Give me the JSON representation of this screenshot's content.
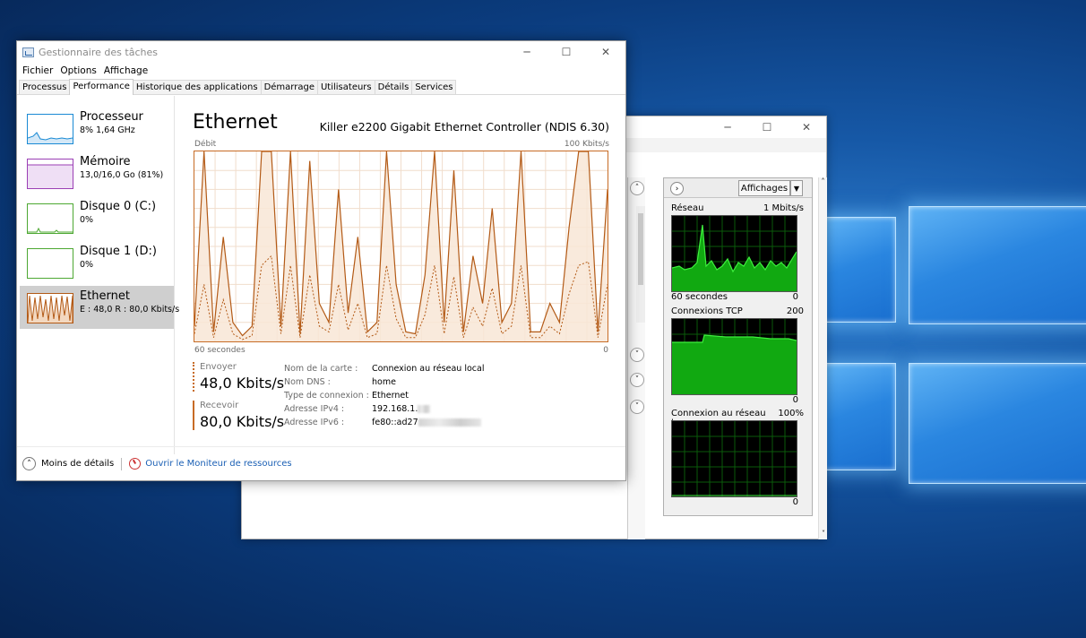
{
  "task_manager": {
    "title": "Gestionnaire des tâches",
    "menu": [
      "Fichier",
      "Options",
      "Affichage"
    ],
    "tabs": [
      "Processus",
      "Performance",
      "Historique des applications",
      "Démarrage",
      "Utilisateurs",
      "Détails",
      "Services"
    ],
    "active_tab": "Performance",
    "sidebar": [
      {
        "name": "Processeur",
        "value": "8% 1,64 GHz",
        "color": "#1a8ad4"
      },
      {
        "name": "Mémoire",
        "value": "13,0/16,0 Go (81%)",
        "color": "#9b3fb5"
      },
      {
        "name": "Disque 0 (C:)",
        "value": "0%",
        "color": "#4da832"
      },
      {
        "name": "Disque 1 (D:)",
        "value": "0%",
        "color": "#4da832"
      },
      {
        "name": "Ethernet",
        "value": "E : 48,0 R : 80,0 Kbits/s",
        "color": "#b35a16"
      }
    ],
    "main": {
      "title": "Ethernet",
      "adapter": "Killer e2200 Gigabit Ethernet Controller (NDIS 6.30)",
      "graph_label": "Débit",
      "graph_max": "100 Kbits/s",
      "graph_time": "60 secondes",
      "graph_min": "0",
      "send_label": "Envoyer",
      "send_value": "48,0 Kbits/s",
      "receive_label": "Recevoir",
      "receive_value": "80,0 Kbits/s",
      "details": [
        {
          "k": "Nom de la carte :",
          "v": "Connexion au réseau local"
        },
        {
          "k": "Nom DNS :",
          "v": "home"
        },
        {
          "k": "Type de connexion :",
          "v": "Ethernet"
        },
        {
          "k": "Adresse IPv4 :",
          "v": "192.168.1."
        },
        {
          "k": "Adresse IPv6 :",
          "v": "fe80::ad27"
        }
      ]
    },
    "footer": {
      "less_details": "Moins de détails",
      "open_monitor": "Ouvrir le Moniteur de ressources"
    },
    "chart_data": {
      "type": "line",
      "ylim": [
        0,
        100
      ],
      "series": [
        {
          "values": [
            8,
            100,
            5,
            55,
            10,
            3,
            8,
            100,
            100,
            8,
            100,
            4,
            95,
            20,
            10,
            80,
            15,
            55,
            5,
            10,
            100,
            30,
            5,
            4,
            35,
            100,
            10,
            90,
            5,
            45,
            20,
            70,
            10,
            20,
            100,
            5,
            5,
            20,
            10,
            60,
            100,
            100,
            5,
            80
          ]
        },
        {
          "values": [
            4,
            30,
            2,
            22,
            4,
            1,
            3,
            40,
            45,
            4,
            40,
            2,
            35,
            8,
            5,
            30,
            6,
            20,
            2,
            4,
            40,
            12,
            2,
            2,
            14,
            40,
            4,
            34,
            2,
            18,
            8,
            28,
            4,
            8,
            40,
            2,
            2,
            8,
            4,
            25,
            40,
            42,
            2,
            30
          ]
        }
      ]
    }
  },
  "resource_monitor": {
    "view_button": "Affichages",
    "graphs": [
      {
        "title": "Réseau",
        "max": "1 Mbits/s",
        "foot_left": "60 secondes",
        "foot_right": "0"
      },
      {
        "title": "Connexions TCP",
        "max": "200",
        "foot_left": "",
        "foot_right": "0"
      },
      {
        "title": "Connexion au réseau lo...",
        "max": "100%",
        "foot_left": "",
        "foot_right": "0"
      }
    ]
  }
}
